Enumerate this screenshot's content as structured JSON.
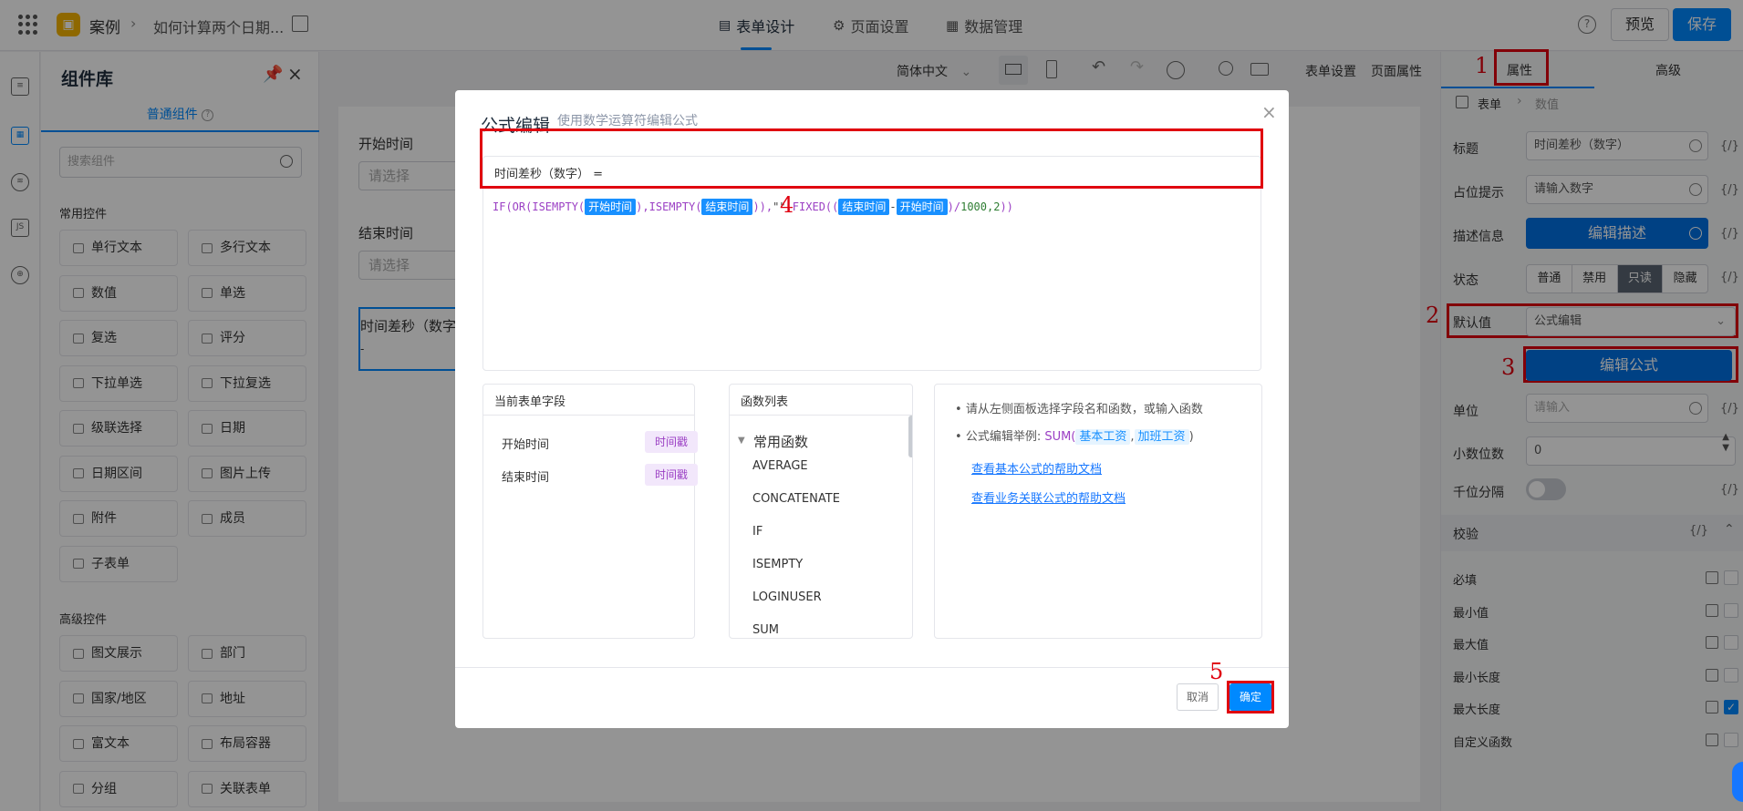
{
  "topbar": {
    "app_name": "案例",
    "page_name": "如何计算两个日期...",
    "tabs": [
      {
        "label": "表单设计",
        "icon": "document-icon",
        "active": true
      },
      {
        "label": "页面设置",
        "icon": "gear-icon",
        "active": false
      },
      {
        "label": "数据管理",
        "icon": "table-icon",
        "active": false
      }
    ],
    "help": "?",
    "preview_label": "预览",
    "save_label": "保存",
    "accent": "#0089ff"
  },
  "library": {
    "title": "组件库",
    "subtab": "普通组件",
    "search_placeholder": "搜索组件",
    "common_section": "常用控件",
    "common_items": [
      "单行文本",
      "多行文本",
      "数值",
      "单选",
      "复选",
      "评分",
      "下拉单选",
      "下拉复选",
      "级联选择",
      "日期",
      "日期区间",
      "图片上传",
      "附件",
      "成员",
      "子表单"
    ],
    "advanced_section": "高级控件",
    "advanced_items": [
      "图文展示",
      "部门",
      "国家/地区",
      "地址",
      "富文本",
      "布局容器",
      "分组",
      "关联表单"
    ]
  },
  "canvas_toolbar": {
    "language": "简体中文",
    "form_settings": "表单设置",
    "page_props": "页面属性"
  },
  "canvas": {
    "start_label": "开始时间",
    "start_placeholder": "请选择",
    "end_label": "结束时间",
    "end_placeholder": "请选择",
    "selected_label": "时间差秒（数字",
    "selected_value": "-"
  },
  "props": {
    "tab_props": "属性",
    "tab_advanced": "高级",
    "crumb_table": "表单",
    "crumb_value": "数值",
    "rows": {
      "title_label": "标题",
      "title_value": "时间差秒（数字）",
      "placeholder_label": "占位提示",
      "placeholder_value": "请输入数字",
      "desc_label": "描述信息",
      "desc_button": "编辑描述",
      "state_label": "状态",
      "state_options": [
        "普通",
        "禁用",
        "只读",
        "隐藏"
      ],
      "state_selected": "只读",
      "default_label": "默认值",
      "default_value": "公式编辑",
      "formula_button": "编辑公式",
      "unit_label": "单位",
      "unit_placeholder": "请输入",
      "decimals_label": "小数位数",
      "decimals_value": "0",
      "thousands_label": "千位分隔",
      "code_token": "{/}"
    },
    "validation_title": "校验",
    "validations": [
      {
        "label": "必填",
        "checked": false
      },
      {
        "label": "最小值",
        "checked": false
      },
      {
        "label": "最大值",
        "checked": false
      },
      {
        "label": "最小长度",
        "checked": false
      },
      {
        "label": "最大长度",
        "checked": true
      },
      {
        "label": "自定义函数",
        "checked": false
      }
    ]
  },
  "modal": {
    "title": "公式编辑",
    "subtitle": "使用数学运算符编辑公式",
    "close": "×",
    "formula_head": "时间差秒（数字） =",
    "formula": {
      "p1": "IF(OR(ISEMPTY(",
      "t1": "开始时间",
      "p2": "),ISEMPTY(",
      "t2": "结束时间",
      "p3": ")),",
      "s1": "\"\"",
      "p4": ",FIXED((",
      "t3": "结束时间",
      "p5": "-",
      "t4": "开始时间",
      "p6": ")/",
      "n1": "1000,2",
      "p7": "))"
    },
    "fields_title": "当前表单字段",
    "fields": [
      {
        "name": "开始时间",
        "type": "时间戳"
      },
      {
        "name": "结束时间",
        "type": "时间戳"
      }
    ],
    "functions_title": "函数列表",
    "function_group": "常用函数",
    "functions": [
      "AVERAGE",
      "CONCATENATE",
      "IF",
      "ISEMPTY",
      "LOGINUSER",
      "SUM"
    ],
    "tip1": "请从左侧面板选择字段名和函数，或输入函数",
    "tip2_prefix": "公式编辑举例: ",
    "tip2_fn": "SUM(",
    "tip2_a": "基本工资",
    "tip2_sep": ",",
    "tip2_b": "加班工资",
    "tip2_end": ")",
    "link1": "查看基本公式的帮助文档",
    "link2": "查看业务关联公式的帮助文档",
    "cancel": "取消",
    "ok": "确定"
  },
  "annotations": [
    "1",
    "2",
    "3",
    "4",
    "5"
  ],
  "annotation_color": "#e0000f"
}
